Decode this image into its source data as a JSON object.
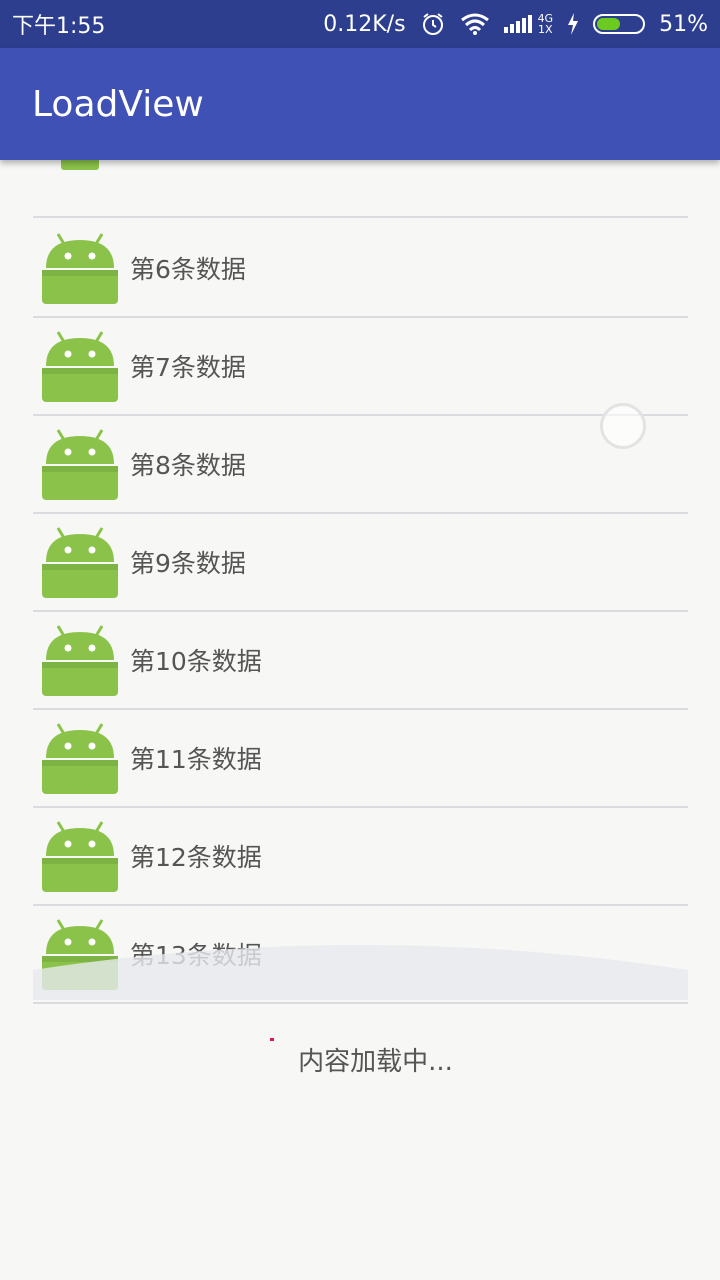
{
  "status_bar": {
    "time": "下午1:55",
    "net_speed": "0.12K/s",
    "network_top": "4G",
    "network_bottom": "1X",
    "battery": "51%",
    "battery_level": 0.51
  },
  "app_bar": {
    "title": "LoadView"
  },
  "list": {
    "items": [
      {
        "label": "第6条数据"
      },
      {
        "label": "第7条数据"
      },
      {
        "label": "第8条数据"
      },
      {
        "label": "第9条数据"
      },
      {
        "label": "第10条数据"
      },
      {
        "label": "第11条数据"
      },
      {
        "label": "第12条数据"
      },
      {
        "label": "第13条数据"
      }
    ],
    "icon": "android-icon"
  },
  "footer": {
    "loading_text": "内容加载中..."
  },
  "colors": {
    "status_bar": "#2d3e8f",
    "app_bar": "#3f51b5",
    "android_green": "#8bc34a",
    "battery_fill": "#6bcb1f"
  }
}
